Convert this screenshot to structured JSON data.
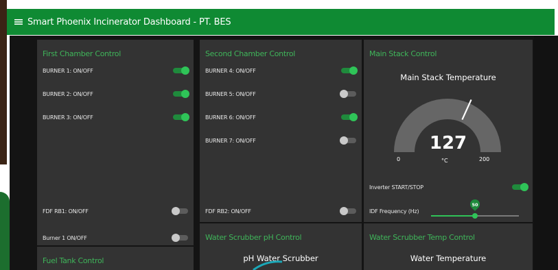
{
  "header": {
    "title": "Smart Phoenix Incinerator Dashboard - PT. BES",
    "menu_icon": "menu-icon"
  },
  "first_chamber": {
    "title": "First Chamber Control",
    "controls": [
      {
        "label": "BURNER 1: ON/OFF",
        "state": true
      },
      {
        "label": "BURNER 2: ON/OFF",
        "state": true
      },
      {
        "label": "BURNER 3: ON/OFF",
        "state": true
      },
      {
        "label": "FDF RB1: ON/OFF",
        "state": false
      },
      {
        "label": "Burner 1 ON/OFF",
        "state": false
      }
    ]
  },
  "second_chamber": {
    "title": "Second Chamber Control",
    "controls": [
      {
        "label": "BURNER 4: ON/OFF",
        "state": true
      },
      {
        "label": "BURNER 5: ON/OFF",
        "state": false
      },
      {
        "label": "BURNER 6: ON/OFF",
        "state": true
      },
      {
        "label": "BURNER 7: ON/OFF",
        "state": false
      },
      {
        "label": "FDF RB2: ON/OFF",
        "state": false
      }
    ]
  },
  "main_stack": {
    "title": "Main Stack Control",
    "gauge": {
      "title": "Main Stack Temperature",
      "value": 127,
      "unit": "°C",
      "min": 0,
      "max": 200,
      "min_label": "0",
      "max_label": "200",
      "value_label": "127"
    },
    "inverter": {
      "label": "Inverter START/STOP",
      "state": true
    },
    "idf": {
      "label": "IDF Frequency (Hz)",
      "value": 50,
      "min": 0,
      "max": 100,
      "value_label": "50"
    }
  },
  "fuel_tank": {
    "title": "Fuel Tank Control"
  },
  "water_ph": {
    "title": "Water Scrubber pH Control",
    "gauge_title": "pH Water Scrubber"
  },
  "water_temp": {
    "title": "Water Scrubber Temp Control",
    "gauge_title": "Water Temperature"
  },
  "colors": {
    "accent": "#0f8a33",
    "card": "#333333",
    "toggle_on": "#2fc458",
    "gauge_track": "#666666"
  }
}
